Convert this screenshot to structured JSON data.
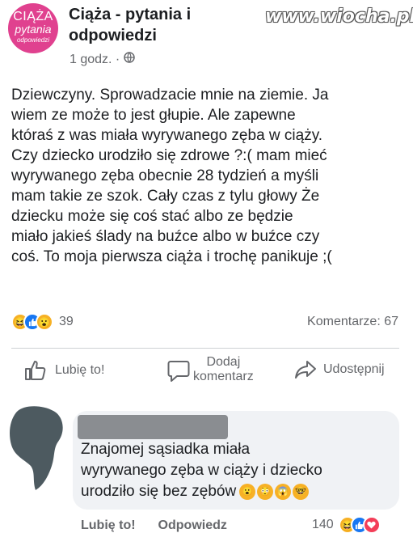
{
  "group": {
    "logo_line1": "CIĄŻA",
    "logo_line2": "pytania",
    "logo_line3": "odpowiedzi",
    "name_line1": "Ciąża - pytania i",
    "name_line2": "odpowiedzi",
    "time": "1 godz. ·",
    "audience_icon": "globe-icon"
  },
  "watermark": "www.wiocha.pl",
  "post": {
    "lines": [
      "Dziewczyny. Sprowadzacie mnie na ziemie. Ja",
      "wiem ze może to jest głupie. Ale zapewne",
      "któraś z was miała wyrywanego zęba w ciąży.",
      "Czy dziecko urodziło się zdrowe ?:( mam mieć",
      "wyrywanego zęba obecnie 28 tydzień a myśli",
      "mam takie ze szok. Cały czas z tylu głowy Że",
      "dziecku może się coś stać  albo ze będzie",
      "miało jakieś ślady na buźce albo w buźce czy",
      "coś. To moja pierwsza ciąża i trochę panikuje ;("
    ],
    "reaction_icons": [
      "haha-icon",
      "like-icon",
      "wow-icon"
    ],
    "reaction_count": "39",
    "comments_count": "Komentarze: 67"
  },
  "actions": {
    "like": "Lubię to!",
    "comment_line1": "Dodaj",
    "comment_line2": "komentarz",
    "share": "Udostępnij"
  },
  "comment": {
    "lines": [
      "Znajomej sąsiadka miała",
      "wyrywanego zęba w ciąży i dziecko",
      "urodziło się bez zębów"
    ],
    "emojis": [
      "wow-icon",
      "flushed-icon",
      "scream-icon",
      "eyes-glasses-icon"
    ],
    "like_label": "Lubię to!",
    "reply_label": "Odpowiedz",
    "reaction_count": "140",
    "reaction_icons": [
      "haha-icon",
      "like-icon",
      "love-icon"
    ]
  },
  "colors": {
    "brand": "#e0418f",
    "facebook_blue": "#1877f2",
    "secondary_text": "#65676b"
  }
}
